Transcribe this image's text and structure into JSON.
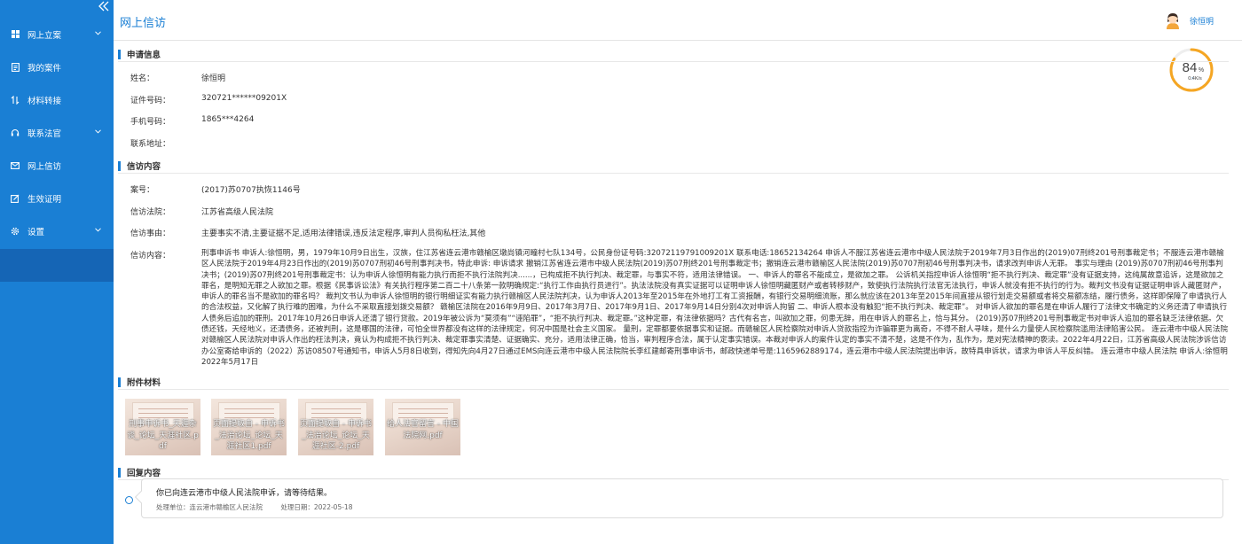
{
  "sidebar": {
    "items": [
      {
        "label": "网上立案",
        "icon": "grid-icon",
        "has_children": true
      },
      {
        "label": "我的案件",
        "icon": "document-icon",
        "has_children": false
      },
      {
        "label": "材料转接",
        "icon": "transfer-icon",
        "has_children": false
      },
      {
        "label": "联系法官",
        "icon": "headset-icon",
        "has_children": true
      },
      {
        "label": "网上信访",
        "icon": "mail-icon",
        "has_children": false
      },
      {
        "label": "生效证明",
        "icon": "edit-certificate-icon",
        "has_children": false
      },
      {
        "label": "设置",
        "icon": "gear-icon",
        "has_children": true
      }
    ]
  },
  "header": {
    "title": "网上信访",
    "user_name": "徐恒明"
  },
  "gauge": {
    "percent": "84",
    "percent_unit": "%",
    "percent_value": 0.84,
    "speed": "0.4K/s"
  },
  "application_info": {
    "title": "申请信息",
    "fields": [
      {
        "label": "姓名：",
        "value": "徐恒明"
      },
      {
        "label": "证件号码：",
        "value": "320721******09201X"
      },
      {
        "label": "手机号码：",
        "value": "1865***4264"
      },
      {
        "label": "联系地址：",
        "value": ""
      }
    ]
  },
  "petition": {
    "title": "信访内容",
    "case_no_label": "案号：",
    "case_no": "(2017)苏0707执恢1146号",
    "court_label": "信访法院：",
    "court": "江苏省高级人民法院",
    "reason_label": "信访事由：",
    "reason": "主要事实不清,主要证据不足,适用法律错误,违反法定程序,审判人员徇私枉法,其他",
    "content_label": "信访内容：",
    "content": "刑事申诉书 申诉人:徐恒明，男，1979年10月9日出生，汉族，住江苏省连云港市赣榆区墩尚镇河疃村七队134号，公民身份证号码:32072119791009201X 联系电话:18652134264 申诉人不服江苏省连云港市中级人民法院于2019年7月3日作出的(2019)07刑终201号刑事裁定书；不服连云港市赣榆区人民法院于2019年4月23日作出的(2019)苏0707刑初46号刑事判决书，特此申诉: 申诉请求 撤销江苏省连云港市中级人民法院(2019)苏07刑终201号刑事裁定书；撤销连云港市赣榆区人民法院(2019)苏0707刑初46号刑事判决书，请求改判申诉人无罪。 事实与理由 (2019)苏0707刑初46号刑事判决书；(2019)苏07刑终201号刑事裁定书：认为申诉人徐恒明有能力执行而拒不执行法院判决......，已构成拒不执行判决、裁定罪，与事实不符，适用法律错误。 一、申诉人的罪名不能成立，是欲加之罪。 公诉机关指控申诉人徐恒明“拒不执行判决、裁定罪”没有证据支持，这纯属故意追诉，这是欲加之罪名，是明知无罪之人欲加之罪。根据《民事诉讼法》有关执行程序第二百二十八条第一款明确规定:“执行工作由执行员进行”。执法法院没有真实证据可以证明申诉人徐恒明藏匿财产或者转移财产，致使执行法院执行法官无法执行，申诉人就没有拒不执行的行为。裁判文书没有证据证明申诉人藏匿财产，申诉人的罪名当不是欲加的罪名吗？ 裁判文书认为申诉人徐恒明的银行明细证实有能力执行赣榆区人民法院判决，认为申诉人2013年至2015年在外地打工有工资报酬，有银行交易明细流账，那么就应该在2013年至2015年间直接从银行划走交易额或者将交易额冻结，履行债务，这样即保障了申请执行人的合法权益，又化解了执行难的困难，为什么不采取直接划拨交易额？ 赣榆区法院在2016年9月9日、2017年3月7日、2017年9月1日、2017年9月14日分别4次对申诉人拘留 二、申诉人根本没有触犯“拒不执行判决、裁定罪”。 对申诉人欲加的罪名是在申诉人履行了法律文书确定的义务还清了申请执行人债务后追加的罪刑。2017年10月26日申诉人还清了银行贷款。2019年被公诉为“莫须有”“诬陷罪”，“拒不执行判决、裁定罪。”这种定罪，有法律依据吗？古代有名言，叫欲加之罪，何患无辞，用在申诉人的罪名上，恰与其分。 (2019)苏07刑终201号刑事裁定书对申诉人追加的罪名缺乏法律依据。欠债还钱，天经地义，还清债务，还被判刑，这是哪国的法律，可怕全世界都没有这样的法律规定，何况中国是社会主义国家。 量刑，定罪都要依据事实和证据。而赣榆区人民检察院对申诉人贷款指控为诈骗罪更为离奇，不得不耐人寻味，是什么力量使人民检察院滥用法律陷害公民。 连云港市中级人民法院对赣榆区人民法院对申诉人作出的枉法判决，竟认为构成拒不执行判决、裁定罪事实清楚、证据确实、充分，适用法律正确，恰当，审判程序合法，属于认定事实错误。本裁对申诉人的案件认定的事实不清不楚，这是不作为，乱作为，是对宪法精神的亵渎。2022年4月22日，江苏省高级人民法院涉诉信访办公室寄给申诉的（2022）苏访08507号通知书，申诉人5月8日收到，得知先向4月27日通过EMS向连云港市中级人民法院院长李红建邮寄刑事申诉书，邮政快递单号是:1165962889174，连云港市中级人民法院提出申诉，故特具申诉状，请求为申诉人平反纠错。 连云港市中级人民法院 申诉人:徐恒明 2022年5月17日"
  },
  "attachments": {
    "title": "附件材料",
    "items": [
      {
        "name": "刑事申诉书_天涯杂谈_论坛_天涯社区.pdf"
      },
      {
        "name": "页面提取自 - 申诉书_法治论坛_论坛_天涯社区1.pdf"
      },
      {
        "name": "页面提取自 - 申诉书_法治论坛_论坛_天涯社区-2.pdf"
      },
      {
        "name": "给人法官留言 - 中国法院网.pdf"
      }
    ]
  },
  "reply": {
    "title": "回复内容",
    "text": "你已向连云港市中级人民法院申诉，请等待结果。",
    "unit": "处理单位：连云港市赣榆区人民法院",
    "date": "处理日期：2022-05-18"
  },
  "colors": {
    "brand": "#1a7fd4",
    "sidebar_active": "#1565b5",
    "gauge_ring": "#f5a623"
  }
}
